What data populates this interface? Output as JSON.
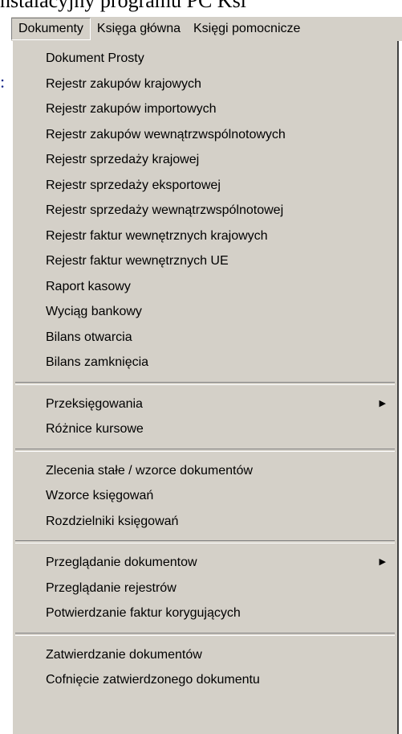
{
  "background": {
    "title_fragment": "nstalacyjny programu PC Ksi",
    "colon": ":"
  },
  "menubar": {
    "items": [
      {
        "label": "Dokumenty",
        "active": true
      },
      {
        "label": "Księga główna",
        "active": false
      },
      {
        "label": "Księgi pomocnicze",
        "active": false
      }
    ]
  },
  "dropdown": {
    "groups": [
      [
        {
          "label": "Dokument Prosty"
        },
        {
          "label": "Rejestr zakupów krajowych"
        },
        {
          "label": "Rejestr zakupów importowych"
        },
        {
          "label": "Rejestr zakupów wewnątrzwspólnotowych"
        },
        {
          "label": "Rejestr sprzedaży krajowej"
        },
        {
          "label": "Rejestr sprzedaży eksportowej"
        },
        {
          "label": "Rejestr sprzedaży wewnątrzwspólnotowej"
        },
        {
          "label": "Rejestr faktur wewnętrznych krajowych"
        },
        {
          "label": "Rejestr faktur wewnętrznych UE"
        },
        {
          "label": "Raport kasowy"
        },
        {
          "label": "Wyciąg bankowy"
        },
        {
          "label": "Bilans otwarcia"
        },
        {
          "label": "Bilans zamknięcia"
        }
      ],
      [
        {
          "label": "Przeksięgowania",
          "submenu": true
        },
        {
          "label": "Różnice kursowe"
        }
      ],
      [
        {
          "label": "Zlecenia stałe / wzorce dokumentów"
        },
        {
          "label": "Wzorce księgowań"
        },
        {
          "label": "Rozdzielniki księgowań"
        }
      ],
      [
        {
          "label": "Przeglądanie dokumentow",
          "submenu": true
        },
        {
          "label": "Przeglądanie rejestrów"
        },
        {
          "label": "Potwierdzanie faktur korygujących"
        }
      ],
      [
        {
          "label": "Zatwierdzanie dokumentów"
        },
        {
          "label": "Cofnięcie zatwierdzonego dokumentu"
        }
      ]
    ],
    "submenu_arrow_icon": "triangle-right-icon"
  }
}
